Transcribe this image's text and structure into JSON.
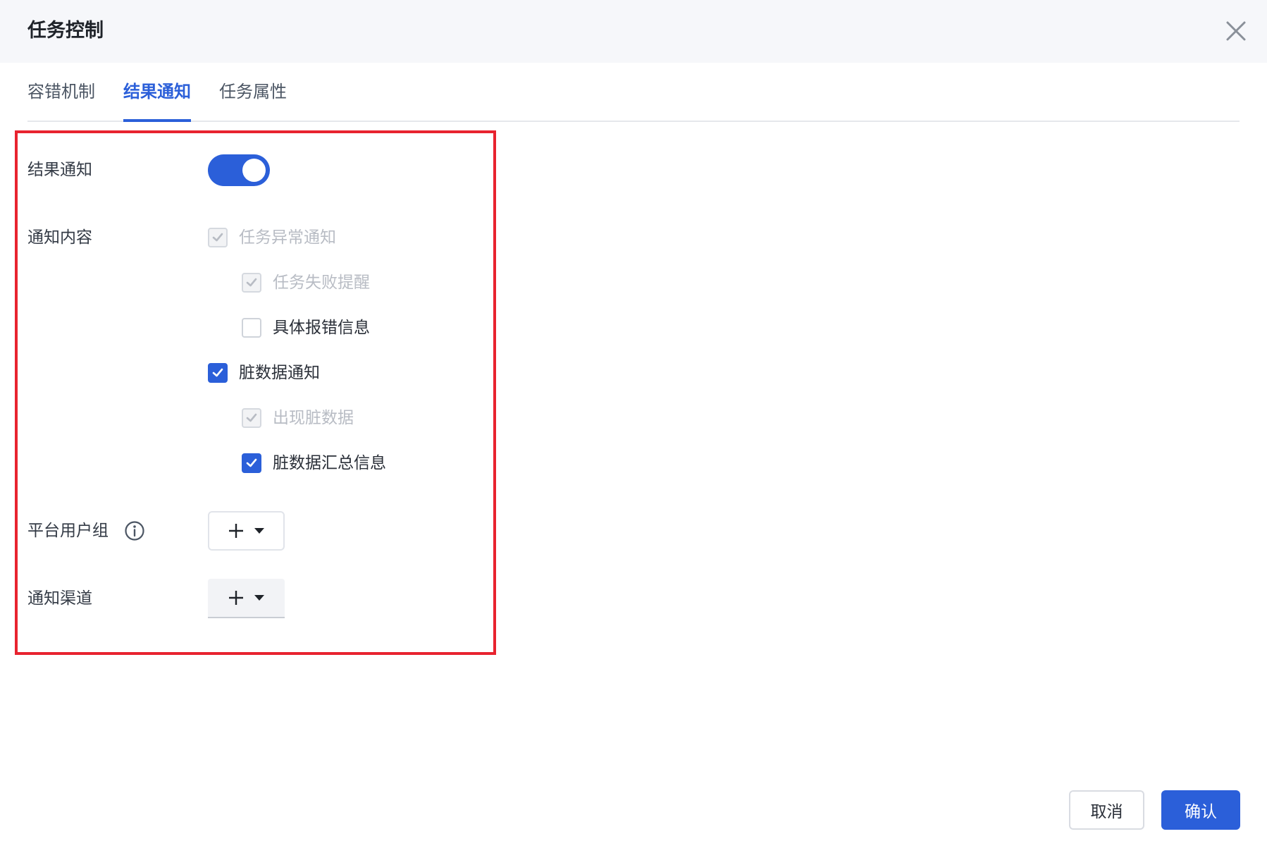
{
  "dialog": {
    "title": "任务控制",
    "close_icon": "close-icon"
  },
  "tabs": [
    {
      "label": "容错机制",
      "active": false
    },
    {
      "label": "结果通知",
      "active": true
    },
    {
      "label": "任务属性",
      "active": false
    }
  ],
  "form": {
    "result_notify": {
      "label": "结果通知",
      "enabled": true
    },
    "notify_content": {
      "label": "通知内容",
      "options": [
        {
          "label": "任务异常通知",
          "checked": true,
          "disabled": true
        },
        {
          "label": "任务失败提醒",
          "checked": true,
          "disabled": true
        },
        {
          "label": "具体报错信息",
          "checked": false,
          "disabled": false
        },
        {
          "label": "脏数据通知",
          "checked": true,
          "disabled": false
        },
        {
          "label": "出现脏数据",
          "checked": true,
          "disabled": true
        },
        {
          "label": "脏数据汇总信息",
          "checked": true,
          "disabled": false
        }
      ]
    },
    "user_group": {
      "label": "平台用户组",
      "add_icon": "plus-icon",
      "dropdown_icon": "caret-down-icon"
    },
    "channel": {
      "label": "通知渠道",
      "add_icon": "plus-icon",
      "dropdown_icon": "caret-down-icon"
    }
  },
  "footer": {
    "cancel_label": "取消",
    "confirm_label": "确认"
  },
  "colors": {
    "primary": "#2b5fd9",
    "highlight": "#e8232f"
  }
}
